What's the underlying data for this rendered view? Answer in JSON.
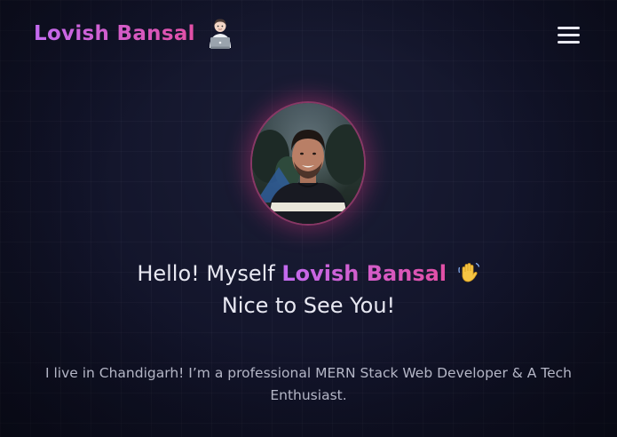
{
  "header": {
    "brand_name": "Lovish Bansal",
    "brand_emoji_icon": "technologist-laptop-icon",
    "menu_icon": "hamburger-menu-icon"
  },
  "hero": {
    "avatar_alt": "profile-photo",
    "greeting_prefix": "Hello! Myself",
    "greeting_name": "Lovish Bansal",
    "wave_icon": "waving-hand-icon",
    "greeting_line2": "Nice to See You!",
    "intro": "I live in Chandigarh! I’m a professional MERN Stack Web Developer & A Tech Enthusiast."
  },
  "colors": {
    "background": "#12142a",
    "accent_start": "#c36bf0",
    "accent_end": "#e24fa5",
    "text": "#e8e8f2",
    "muted_text": "#b4b6c6"
  }
}
